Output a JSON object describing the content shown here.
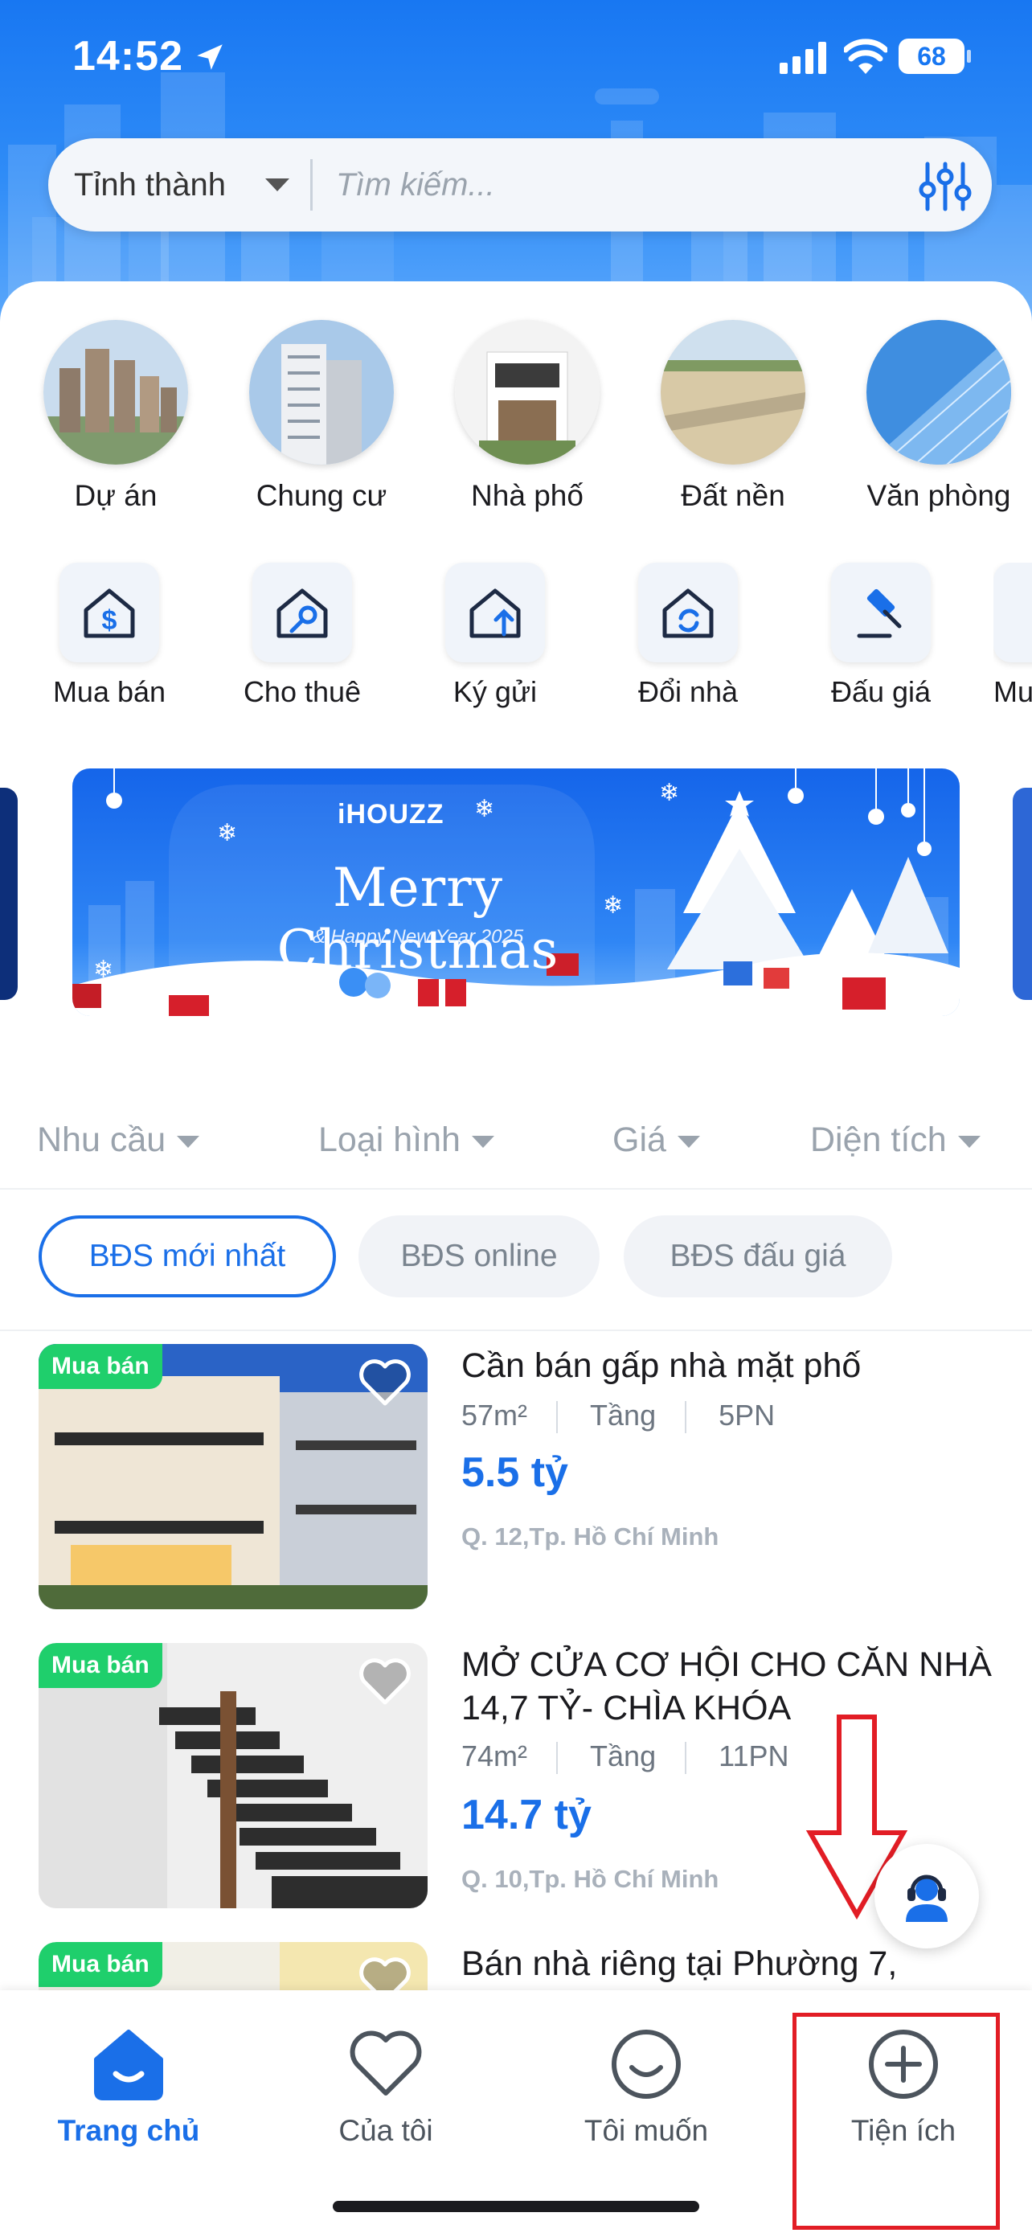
{
  "status_bar": {
    "time": "14:52",
    "battery": "68"
  },
  "search": {
    "province_label": "Tỉnh thành",
    "placeholder": "Tìm kiếm..."
  },
  "categories": [
    {
      "label": "Dự án",
      "icon": "project-thumbnail"
    },
    {
      "label": "Chung cư",
      "icon": "apartment-thumbnail"
    },
    {
      "label": "Nhà phố",
      "icon": "townhouse-thumbnail"
    },
    {
      "label": "Đất nền",
      "icon": "land-thumbnail"
    },
    {
      "label": "Văn phòng",
      "icon": "office-thumbnail"
    }
  ],
  "services": [
    {
      "label": "Mua bán",
      "icon": "house-dollar-icon"
    },
    {
      "label": "Cho thuê",
      "icon": "house-key-icon"
    },
    {
      "label": "Ký gửi",
      "icon": "house-upload-icon"
    },
    {
      "label": "Đổi nhà",
      "icon": "house-exchange-icon"
    },
    {
      "label": "Đấu giá",
      "icon": "gavel-icon"
    },
    {
      "label": "Mu"
    }
  ],
  "banner": {
    "brand": "iHOUZZ",
    "headline": "Merry Christmas",
    "subline": "& Happy New Year 2025"
  },
  "filters": [
    {
      "label": "Nhu cầu"
    },
    {
      "label": "Loại hình"
    },
    {
      "label": "Giá"
    },
    {
      "label": "Diện tích"
    }
  ],
  "tabs": [
    {
      "label": "BĐS mới nhất",
      "active": true
    },
    {
      "label": "BĐS online",
      "active": false
    },
    {
      "label": "BĐS đấu giá",
      "active": false
    }
  ],
  "listings": [
    {
      "badge": "Mua bán",
      "title": "Cần bán gấp nhà mặt phố",
      "area": "57m²",
      "floor": "Tầng",
      "rooms": "5PN",
      "price": "5.5 tỷ",
      "address": "Q. 12,Tp. Hồ Chí Minh"
    },
    {
      "badge": "Mua bán",
      "title": "MỞ CỬA CƠ HỘI CHO CĂN NHÀ 14,7 TỶ- CHÌA KHÓA",
      "area": "74m²",
      "floor": "Tầng",
      "rooms": "11PN",
      "price": "14.7 tỷ",
      "address": "Q. 10,Tp. Hồ Chí Minh"
    },
    {
      "badge": "Mua bán",
      "title": "Bán nhà riêng tại Phường 7,"
    }
  ],
  "bottom_nav": [
    {
      "label": "Trang chủ",
      "icon": "home-icon",
      "active": true
    },
    {
      "label": "Của tôi",
      "icon": "heart-icon",
      "active": false
    },
    {
      "label": "Tôi muốn",
      "icon": "smile-icon",
      "active": false
    },
    {
      "label": "Tiện ích",
      "icon": "plus-circle-icon",
      "active": false
    }
  ],
  "colors": {
    "brand_blue": "#1a6fe8",
    "badge_green": "#1fcf6c",
    "annotation_red": "#e21d25"
  }
}
